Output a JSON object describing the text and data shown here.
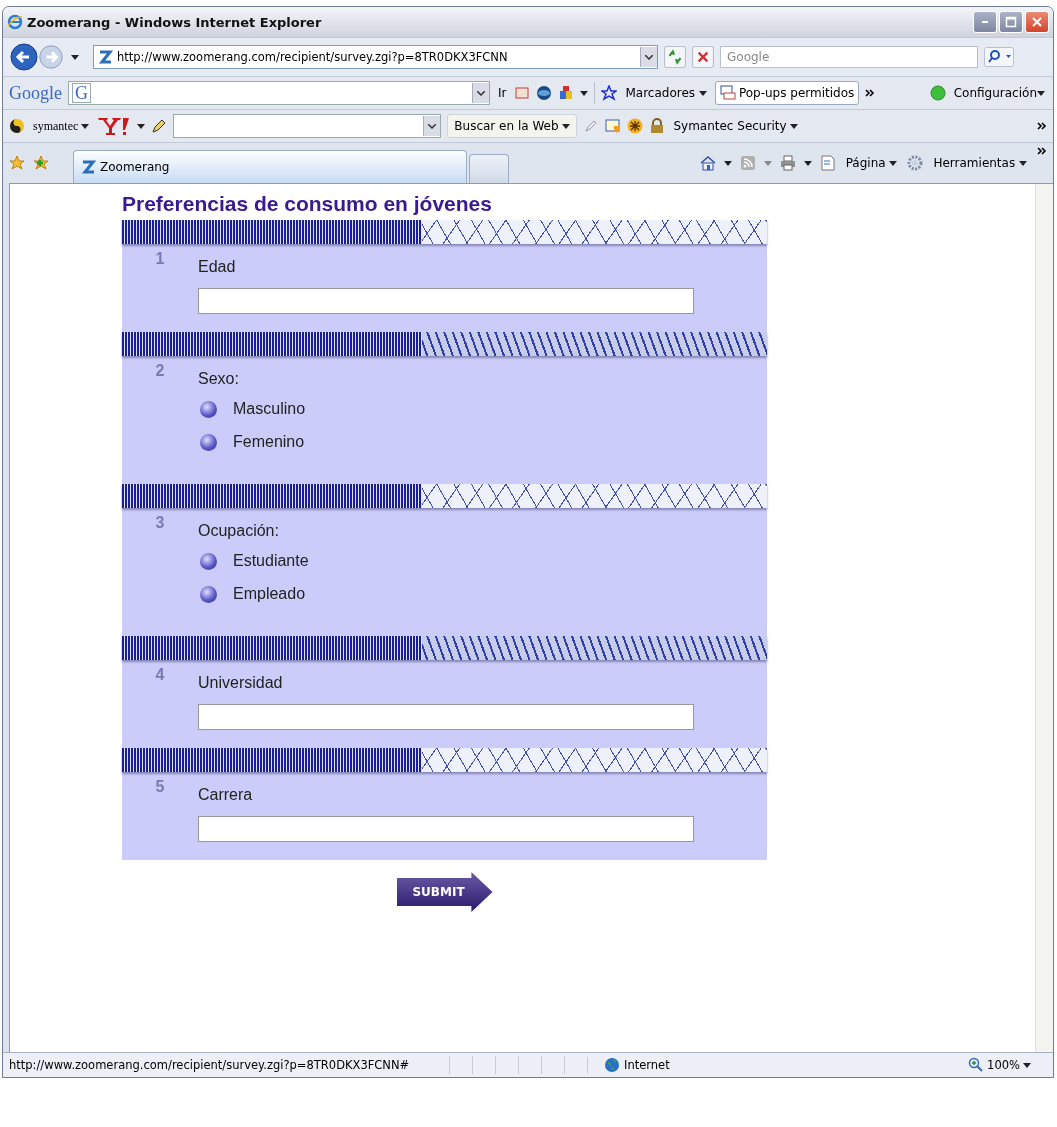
{
  "window": {
    "title": "Zoomerang - Windows Internet Explorer"
  },
  "address_bar": {
    "url": "http://www.zoomerang.com/recipient/survey.zgi?p=8TR0DKX3FCNN"
  },
  "search_box": {
    "placeholder": "Google"
  },
  "google_toolbar": {
    "logo": "Google",
    "g_button": "G",
    "go_button": "Ir",
    "bookmarks": "Marcadores",
    "popups": "Pop-ups permitidos",
    "settings": "Configuración"
  },
  "symantec_toolbar": {
    "brand": "symantec",
    "search_button": "Buscar en la Web",
    "security": "Symantec Security"
  },
  "tabs": [
    {
      "label": "Zoomerang",
      "selected": true
    }
  ],
  "command_bar": {
    "page": "Página",
    "tools": "Herramientas"
  },
  "survey": {
    "title": "Preferencias de consumo en jóvenes",
    "questions": [
      {
        "number": "1",
        "label": "Edad",
        "kind": "text"
      },
      {
        "number": "2",
        "label": "Sexo:",
        "kind": "radio",
        "options": [
          {
            "label": "Masculino",
            "selected": false
          },
          {
            "label": "Femenino",
            "selected": false
          }
        ]
      },
      {
        "number": "3",
        "label": "Ocupación:",
        "kind": "radio",
        "options": [
          {
            "label": "Estudiante",
            "selected": false
          },
          {
            "label": "Empleado",
            "selected": false
          }
        ]
      },
      {
        "number": "4",
        "label": "Universidad",
        "kind": "text"
      },
      {
        "number": "5",
        "label": "Carrera",
        "kind": "text"
      }
    ],
    "submit": "SUBMIT"
  },
  "status_bar": {
    "url": "http://www.zoomerang.com/recipient/survey.zgi?p=8TR0DKX3FCNN#",
    "zone": "Internet",
    "zoom": "100%"
  }
}
